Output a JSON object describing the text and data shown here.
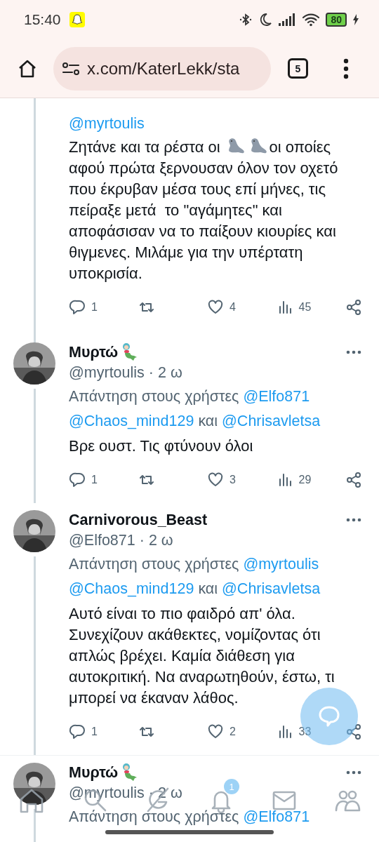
{
  "status_bar": {
    "time": "15:40",
    "battery": "80"
  },
  "browser": {
    "url": "x.com/KaterLekk/sta",
    "tab_count": "5"
  },
  "tweets": [
    {
      "reply_to": {
        "mentions": [
          "@myrtoulis"
        ]
      },
      "body": [
        {
          "kind": "text",
          "text": "Ζητάνε και τα ρέστα οι"
        },
        {
          "kind": "seal"
        },
        {
          "kind": "seal"
        },
        {
          "kind": "text",
          "text": "οι οποίες"
        },
        {
          "kind": "text",
          "text": "αφού πρώτα ξερνουσαν όλον τον οχετό που έκρυβαν μέσα τους επί μήνες, τις πείραξε μετά  το \"αγάμητες\" και αποφάσισαν να το παίξουν κιουρίες και θιγμενες. Μιλάμε για την υπέρτατη υποκρισία."
        }
      ],
      "actions": {
        "replies": "1",
        "likes": "4",
        "views": "45"
      }
    },
    {
      "name": "Μυρτώ",
      "badge": {
        "kind": "mermaid"
      },
      "handle": "@myrtoulis",
      "separator": "·",
      "time": "2 ω",
      "reply_to": {
        "prefix": "Απάντηση στους χρήστες",
        "mentions": [
          "@Elfo871",
          "@Chaos_mind129",
          "@Chrisavletsa"
        ],
        "joiner": "και"
      },
      "body": [
        {
          "kind": "text",
          "text": "Βρε ουστ. Τις φτύνουν όλοι"
        }
      ],
      "actions": {
        "replies": "1",
        "likes": "3",
        "views": "29"
      }
    },
    {
      "name": "Carnivorous_Beast",
      "handle": "@Elfo871",
      "separator": "·",
      "time": "2 ω",
      "reply_to": {
        "prefix": "Απάντηση στους χρήστες",
        "mentions": [
          "@myrtoulis",
          "@Chaos_mind129",
          "@Chrisavletsa"
        ],
        "joiner": "και"
      },
      "body": [
        {
          "kind": "text",
          "text": "Αυτό είναι το πιο φαιδρό απ' όλα. Συνεχίζουν ακάθεκτες, νομίζοντας ότι απλώς βρέχει. Καμία διάθεση για αυτοκριτική. Να αναρωτηθούν, έστω, τι μπορεί να έκαναν λάθος."
        }
      ],
      "actions": {
        "replies": "1",
        "likes": "2",
        "views": "33"
      }
    },
    {
      "name": "Μυρτώ",
      "badge": {
        "kind": "mermaid"
      },
      "handle": "@myrtoulis",
      "separator": "·",
      "time": "2 ω",
      "reply_to": {
        "prefix": "Απάντηση στους χρήστες",
        "mentions": [
          "@Elfo871"
        ]
      }
    }
  ],
  "bottom_nav": [
    {
      "kind": "home"
    },
    {
      "kind": "search"
    },
    {
      "kind": "grok"
    },
    {
      "kind": "bell",
      "badge": "1"
    },
    {
      "kind": "mail"
    },
    {
      "kind": "people"
    }
  ]
}
